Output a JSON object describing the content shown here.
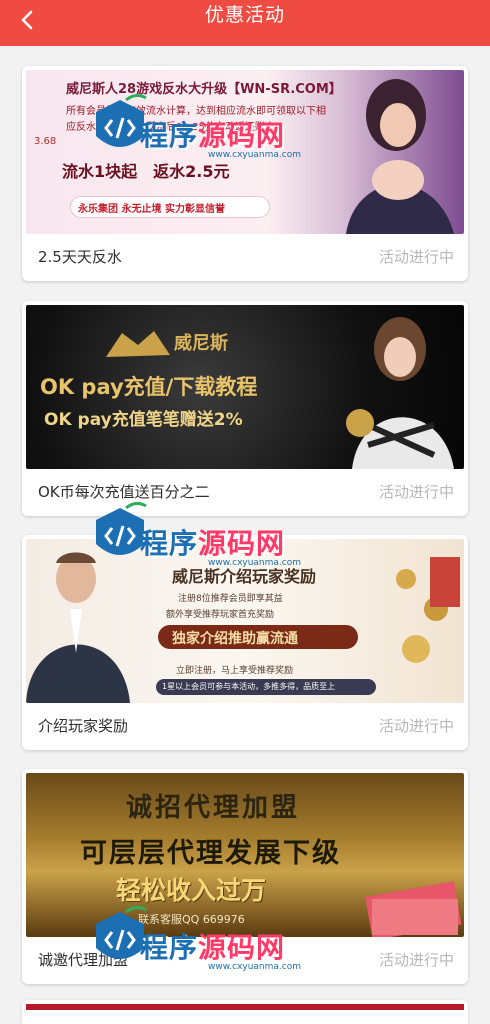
{
  "header": {
    "title": "优惠活动",
    "back_icon": "chevron-left-icon"
  },
  "promotions": [
    {
      "caption": "2.5天天反水",
      "status": "活动进行中",
      "banner": {
        "headline": "威尼斯人28游戏反水大升级【WN-SR.COM】",
        "line1": "所有会员按照有效流水计算，达到相应流水即可领取以下相",
        "line2": "应反水，天天返，返水后00:35分自动返还账户",
        "line3": "3.68",
        "line4": "流水1块起　返水2.5元",
        "line5": "永乐集团 永无止境 实力彰显信誉"
      }
    },
    {
      "caption": "OK币每次充值送百分之二",
      "status": "活动进行中",
      "banner": {
        "brand": "威尼斯",
        "headline": "OK pay充值/下载教程",
        "subline": "OK pay充值笔笔赠送2%"
      }
    },
    {
      "caption": "介绍玩家奖励",
      "status": "活动进行中",
      "banner": {
        "headline": "威尼斯介绍玩家奖励",
        "line1": "注册8位推荐会员即享其益",
        "line2": "额外享受推荐玩家首充奖励",
        "tag": "独家介绍推助赢流通",
        "line3": "立即注册，马上享受推荐奖励",
        "line4": "1星以上会员可参与本活动，多推多得，品质至上"
      }
    },
    {
      "caption": "诚邀代理加盟",
      "status": "活动进行中",
      "banner": {
        "headline": "诚招代理加盟",
        "subline": "可层层代理发展下级",
        "tag": "轻松收入过万",
        "contact": "联系客服QQ 669976"
      }
    }
  ],
  "watermark": {
    "text_blue": "程序",
    "text_pink": "源码网",
    "url": "www.cxyuanma.com",
    "icon": "code-badge-icon"
  },
  "colors": {
    "header_bg": "#ef4b43",
    "caption": "#303030",
    "status": "#b8b8b8"
  }
}
